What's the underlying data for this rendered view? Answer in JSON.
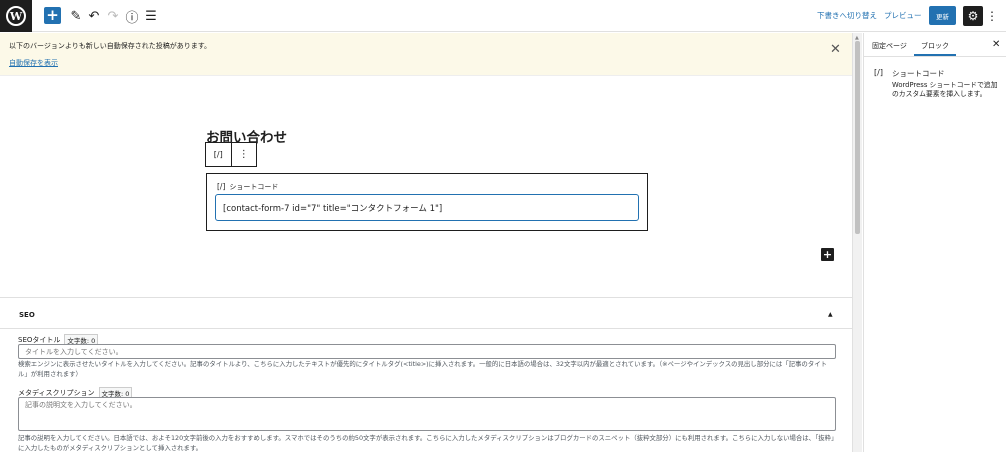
{
  "topbar": {
    "logo": "W",
    "add_icon": "+",
    "tool_icons": [
      "✎",
      "↶",
      "↷",
      "ⓘ",
      "☰"
    ],
    "switch_to_draft": "下書きへ切り替え",
    "preview": "プレビュー",
    "update": "更新",
    "settings_icon": "gear-icon",
    "more_icon": "⋮"
  },
  "notice": {
    "message": "以下のバージョンよりも新しい自動保存された投稿があります。",
    "link": "自動保存を表示",
    "close": "✕"
  },
  "editor": {
    "title": "お問い合わせ",
    "block_type_icon": "[/]",
    "block_more_icon": "⋮",
    "block_label": "ショートコード",
    "shortcode_value": "[contact-form-7 id=\"7\" title=\"コンタクトフォーム 1\"]",
    "add_block_icon": "+"
  },
  "seo": {
    "title": "SEO",
    "toggle": "▲",
    "seo_title_label": "SEOタイトル",
    "seo_title_count": "文字数: 0",
    "seo_title_placeholder": "タイトルを入力してください。",
    "seo_title_help": "検索エンジンに表示させたいタイトルを入力してください。記事のタイトルより、こちらに入力したテキストが優先的にタイトルタグ(<title>)に挿入されます。一般的に日本語の場合は、32文字以内が最適とされています。（※ページやインデックスの見出し部分には「記事のタイトル」が利用されます）",
    "meta_desc_label": "メタディスクリプション",
    "meta_desc_count": "文字数: 0",
    "meta_desc_placeholder": "記事の説明文を入力してください。",
    "meta_desc_help": "記事の説明を入力してください。日本語では、およそ120文字前後の入力をおすすめします。スマホではそのうちの約50文字が表示されます。こちらに入力したメタディスクリプションはブログカードのスニペット（抜粋文部分）にも利用されます。こちらに入力しない場合は、「抜粋」に入力したものがメタディスクリプションとして挿入されます。"
  },
  "sidebar": {
    "tab_document": "固定ページ",
    "tab_block": "ブロック",
    "close": "✕",
    "block_icon": "[/]",
    "block_name": "ショートコード",
    "block_desc": "WordPress ショートコードで追加のカスタム要素を挿入します。"
  }
}
